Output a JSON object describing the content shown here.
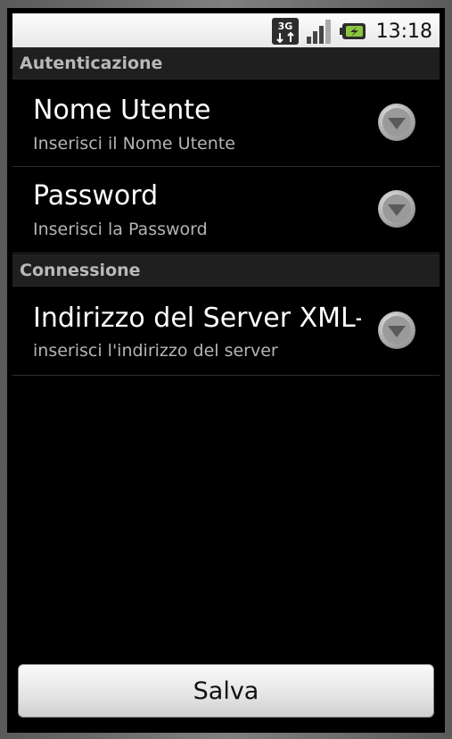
{
  "status_bar": {
    "network_icon": "3g-data-icon",
    "signal_icon": "signal-strength-icon",
    "battery_icon": "battery-charging-icon",
    "time": "13:18",
    "network_label": "3G"
  },
  "sections": [
    {
      "header": "Autenticazione",
      "items": [
        {
          "title": "Nome Utente",
          "summary": "Inserisci il Nome Utente"
        },
        {
          "title": "Password",
          "summary": "Inserisci la Password"
        }
      ]
    },
    {
      "header": "Connessione",
      "items": [
        {
          "title": "Indirizzo del Server XML-RPC",
          "summary": "inserisci l'indirizzo del server"
        }
      ]
    }
  ],
  "save_button": {
    "label": "Salva"
  },
  "colors": {
    "background": "#000000",
    "category_bg": "#1f1f1f",
    "title_text": "#ffffff",
    "summary_text": "#b4b4b4",
    "battery_accent": "#8cc63f"
  }
}
